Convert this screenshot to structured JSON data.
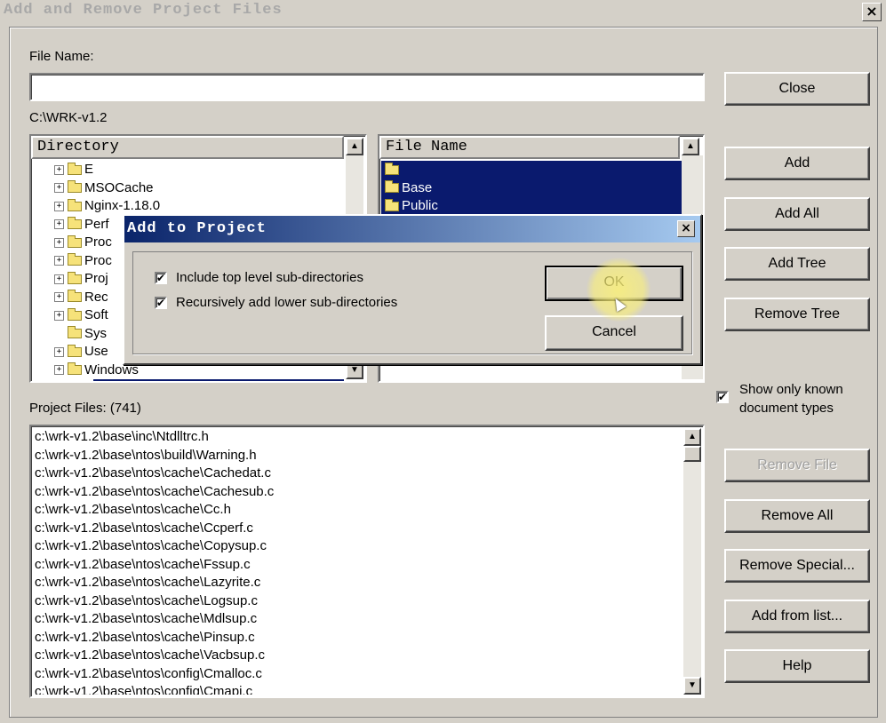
{
  "window": {
    "title": "Add and Remove Project Files",
    "close_glyph": "×"
  },
  "file_name": {
    "label": "File Name:",
    "value": ""
  },
  "current_path": "C:\\WRK-v1.2",
  "directory": {
    "header": "Directory",
    "items": [
      "E",
      "MSOCache",
      "Nginx-1.18.0",
      "Perf",
      "Proc",
      "Proc",
      "Proj",
      "Rec",
      "Soft",
      "Sys",
      "Use",
      "Windows"
    ],
    "expandable": [
      true,
      true,
      true,
      true,
      true,
      true,
      true,
      true,
      true,
      false,
      true,
      true
    ]
  },
  "file_list": {
    "header": "File Name",
    "items": [
      "",
      "Base",
      "Public"
    ]
  },
  "buttons": {
    "close": "Close",
    "add": "Add",
    "add_all": "Add All",
    "add_tree": "Add Tree",
    "remove_tree": "Remove Tree",
    "remove_file": "Remove File",
    "remove_all": "Remove All",
    "remove_special": "Remove Special...",
    "add_from_list": "Add from list...",
    "help": "Help"
  },
  "show_known": {
    "label_line1": "Show only known",
    "label_line2": "document types",
    "checked": true
  },
  "project_files": {
    "label": "Project Files: (741)",
    "items": [
      "c:\\wrk-v1.2\\base\\inc\\Ntdlltrc.h",
      "c:\\wrk-v1.2\\base\\ntos\\build\\Warning.h",
      "c:\\wrk-v1.2\\base\\ntos\\cache\\Cachedat.c",
      "c:\\wrk-v1.2\\base\\ntos\\cache\\Cachesub.c",
      "c:\\wrk-v1.2\\base\\ntos\\cache\\Cc.h",
      "c:\\wrk-v1.2\\base\\ntos\\cache\\Ccperf.c",
      "c:\\wrk-v1.2\\base\\ntos\\cache\\Copysup.c",
      "c:\\wrk-v1.2\\base\\ntos\\cache\\Fssup.c",
      "c:\\wrk-v1.2\\base\\ntos\\cache\\Lazyrite.c",
      "c:\\wrk-v1.2\\base\\ntos\\cache\\Logsup.c",
      "c:\\wrk-v1.2\\base\\ntos\\cache\\Mdlsup.c",
      "c:\\wrk-v1.2\\base\\ntos\\cache\\Pinsup.c",
      "c:\\wrk-v1.2\\base\\ntos\\cache\\Vacbsup.c",
      "c:\\wrk-v1.2\\base\\ntos\\config\\Cmalloc.c",
      "c:\\wrk-v1.2\\base\\ntos\\config\\Cmapi.c"
    ]
  },
  "dialog": {
    "title": "Add to Project",
    "close_glyph": "×",
    "option1": "Include top level sub-directories",
    "option2": "Recursively add lower sub-directories",
    "option1_checked": true,
    "option2_checked": true,
    "ok": "OK",
    "cancel": "Cancel"
  },
  "glyphs": {
    "check": "✔",
    "up": "▲",
    "down": "▼",
    "plus": "+"
  }
}
